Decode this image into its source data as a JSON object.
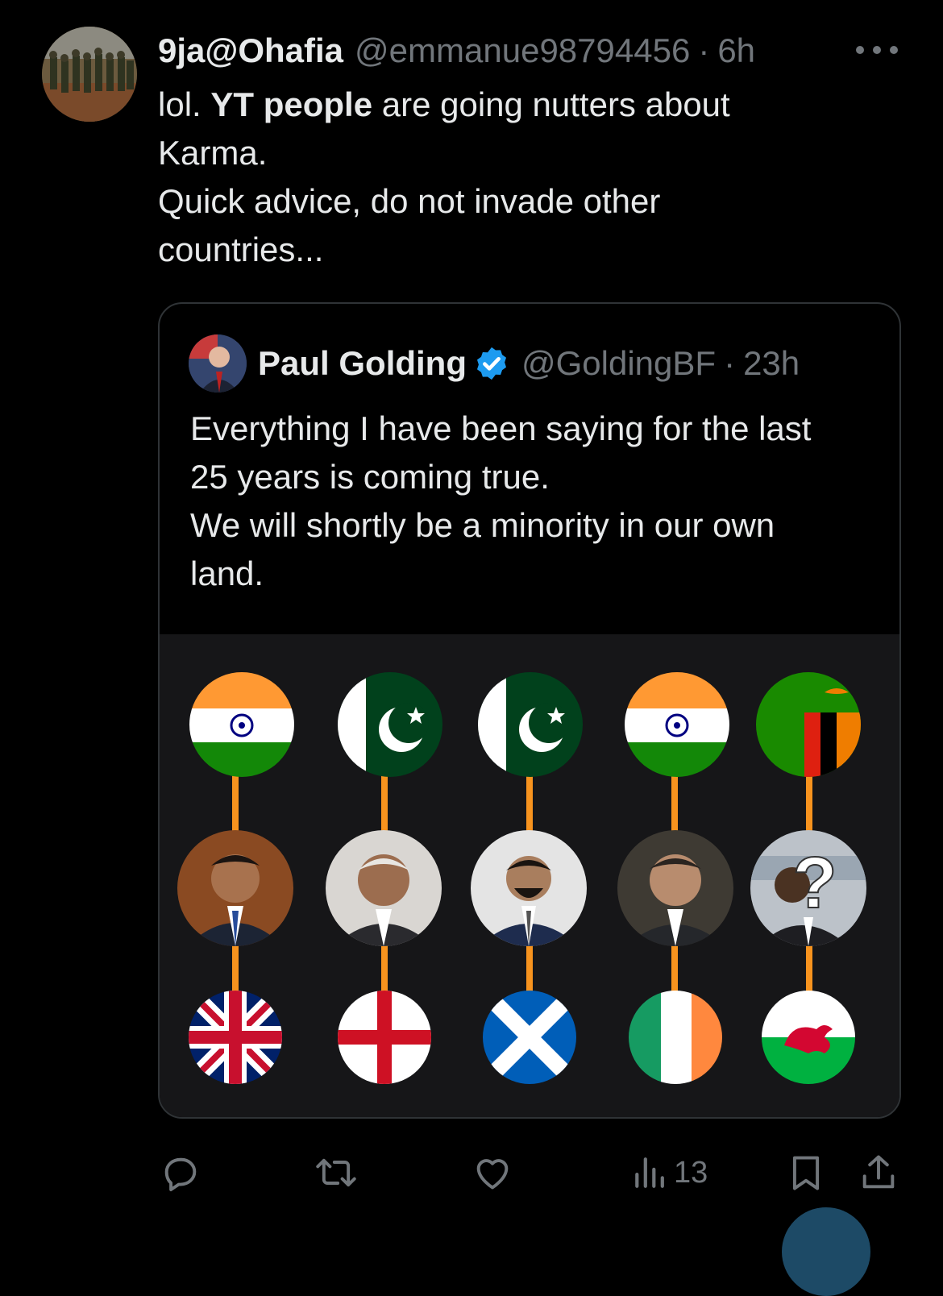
{
  "tweet": {
    "display_name": "9ja@Ohafia",
    "handle": "@emmanue98794456",
    "separator": "·",
    "time": "6h",
    "avatar_icon": "soldiers-photo-avatar",
    "text_lines": [
      {
        "plain_before": "lol. ",
        "bold": "YT people",
        "plain_after": " are going nutters about"
      },
      {
        "text": "Karma."
      },
      {
        "text": "Quick advice, do not invade other"
      },
      {
        "text": "countries..."
      }
    ]
  },
  "quoted_tweet": {
    "display_name": "Paul Golding",
    "verified_icon": "verified-badge-icon",
    "handle": "@GoldingBF",
    "separator": "·",
    "time": "23h",
    "text_lines": [
      "Everything I have been saying for the last",
      "25 years is coming true.",
      "We will shortly be a minority in our own",
      "land."
    ],
    "image": {
      "columns": [
        {
          "origin_flag": "india-flag",
          "person": "politician-photo-1",
          "country_flag": "union-jack-flag"
        },
        {
          "origin_flag": "pakistan-flag",
          "person": "politician-photo-2",
          "country_flag": "england-flag"
        },
        {
          "origin_flag": "pakistan-flag",
          "person": "politician-photo-3",
          "country_flag": "scotland-flag"
        },
        {
          "origin_flag": "india-flag",
          "person": "politician-photo-4",
          "country_flag": "ireland-flag"
        },
        {
          "origin_flag": "zambia-flag",
          "person": "unknown-person-question-mark",
          "country_flag": "wales-flag"
        }
      ],
      "question_mark": "?"
    }
  },
  "actions": {
    "reply_icon": "reply-icon",
    "repost_icon": "repost-icon",
    "like_icon": "like-icon",
    "views_icon": "views-icon",
    "views_count": "13",
    "bookmark_icon": "bookmark-icon",
    "share_icon": "share-icon"
  },
  "colors": {
    "background": "#000000",
    "text": "#e7e9ea",
    "muted": "#71767b",
    "verified": "#1d9bf0",
    "connector": "#f7931e"
  }
}
